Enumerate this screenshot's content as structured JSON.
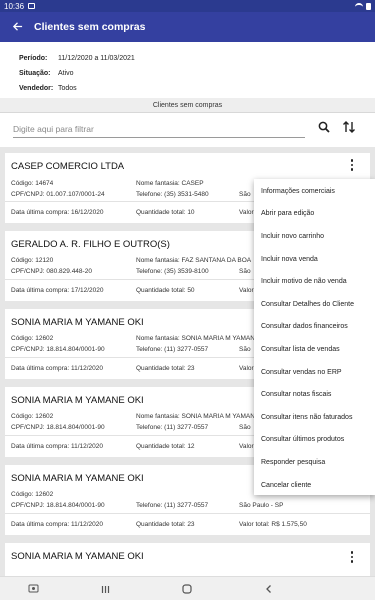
{
  "status": {
    "time": "10:36"
  },
  "appbar": {
    "title": "Clientes sem compras"
  },
  "info": {
    "periodo_label": "Período:",
    "periodo_value": "11/12/2020 a 11/03/2021",
    "situacao_label": "Situação:",
    "situacao_value": "Ativo",
    "vendedor_label": "Vendedor:",
    "vendedor_value": "Todos"
  },
  "section_title": "Clientes sem compras",
  "filter": {
    "placeholder": "Digite aqui para filtrar"
  },
  "clients": [
    {
      "name": "CASEP COMERCIO LTDA",
      "codigo": "Código: 14674",
      "fantasia": "Nome fantasia: CASEP",
      "cnpj": "CPF/CNPJ: 01.007.107/0001-24",
      "telefone": "Telefone: (35) 3531-5480",
      "cidade": "São",
      "data": "Data última compra: 16/12/2020",
      "quantidade": "Quantidade total: 10",
      "valor": "Valor"
    },
    {
      "name": "GERALDO A. R. FILHO E OUTRO(S)",
      "codigo": "Código: 12120",
      "fantasia": "Nome fantasia: FAZ SANTANA DA BOA",
      "cnpj": "CPF/CNPJ: 080.829.448-20",
      "telefone": "Telefone: (35) 3539-8100",
      "cidade": "São",
      "data": "Data última compra: 17/12/2020",
      "quantidade": "Quantidade total: 50",
      "valor": "Valor"
    },
    {
      "name": "SONIA MARIA M YAMANE OKI",
      "codigo": "Código: 12602",
      "fantasia": "Nome fantasia: SONIA MARIA M YAMANE",
      "cnpj": "CPF/CNPJ: 18.814.804/0001-90",
      "telefone": "Telefone: (11) 3277-0557",
      "cidade": "São",
      "data": "Data última compra: 11/12/2020",
      "quantidade": "Quantidade total: 23",
      "valor": "Valor"
    },
    {
      "name": "SONIA MARIA M YAMANE OKI",
      "codigo": "Código: 12602",
      "fantasia": "Nome fantasia: SONIA MARIA M YAMANE",
      "cnpj": "CPF/CNPJ: 18.814.804/0001-90",
      "telefone": "Telefone: (11) 3277-0557",
      "cidade": "São",
      "data": "Data última compra: 11/12/2020",
      "quantidade": "Quantidade total: 12",
      "valor": "Valor"
    },
    {
      "name": "SONIA MARIA M YAMANE OKI",
      "codigo": "Código: 12602",
      "fantasia": "",
      "cnpj": "CPF/CNPJ: 18.814.804/0001-90",
      "telefone": "Telefone: (11) 3277-0557",
      "cidade": "São Paulo - SP",
      "data": "Data última compra: 11/12/2020",
      "quantidade": "Quantidade total: 23",
      "valor": "Valor total: R$ 1.575,50"
    },
    {
      "name": "SONIA MARIA M YAMANE OKI"
    }
  ],
  "menu": [
    "Informações comerciais",
    "Abrir para edição",
    "Incluir novo carrinho",
    "Incluir nova venda",
    "Incluir motivo de não venda",
    "Consultar Detalhes do Cliente",
    "Consultar dados financeiros",
    "Consultar lista de vendas",
    "Consultar vendas no ERP",
    "Consultar notas fiscais",
    "Consultar itens não faturados",
    "Consultar últimos produtos",
    "Responder pesquisa",
    "Cancelar cliente"
  ],
  "icons": {
    "back": "arrow-left-icon",
    "search": "search-icon",
    "sort": "sort-icon",
    "more": "more-vert-icon",
    "recent": "recents-icon",
    "home": "home-icon",
    "nav_back": "nav-back-icon"
  },
  "colors": {
    "appbar": "#3440a0",
    "statusbar": "#2b3a8f"
  }
}
